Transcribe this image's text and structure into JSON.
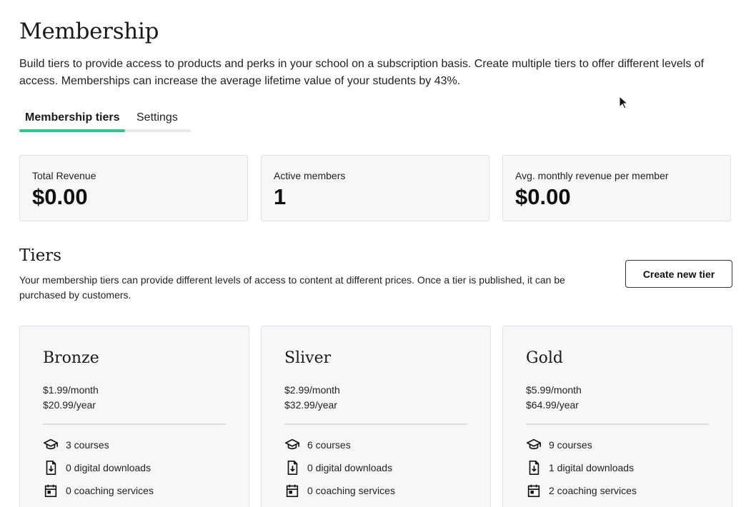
{
  "page": {
    "title": "Membership",
    "intro": "Build tiers to provide access to products and perks in your school on a subscription basis. Create multiple tiers to offer different levels of access. Memberships can increase the average lifetime value of your students by 43%."
  },
  "tabs": [
    {
      "label": "Membership tiers",
      "active": true
    },
    {
      "label": "Settings",
      "active": false
    }
  ],
  "accent_color": "#3bbf8c",
  "stats": [
    {
      "label": "Total Revenue",
      "value": "$0.00"
    },
    {
      "label": "Active members",
      "value": "1"
    },
    {
      "label": "Avg. monthly revenue per member",
      "value": "$0.00"
    }
  ],
  "tiers_section": {
    "heading": "Tiers",
    "description": "Your membership tiers can provide different levels of access to content at different prices. Once a tier is published, it can be purchased by customers.",
    "create_button": "Create new tier"
  },
  "tiers": [
    {
      "name": "Bronze",
      "monthly": "$1.99/month",
      "yearly": "$20.99/year",
      "features": [
        {
          "icon": "graduation-cap-icon",
          "text": "3 courses"
        },
        {
          "icon": "download-file-icon",
          "text": "0 digital downloads"
        },
        {
          "icon": "calendar-icon",
          "text": "0 coaching services"
        }
      ]
    },
    {
      "name": "Sliver",
      "monthly": "$2.99/month",
      "yearly": "$32.99/year",
      "features": [
        {
          "icon": "graduation-cap-icon",
          "text": "6 courses"
        },
        {
          "icon": "download-file-icon",
          "text": "0 digital downloads"
        },
        {
          "icon": "calendar-icon",
          "text": "0 coaching services"
        }
      ]
    },
    {
      "name": "Gold",
      "monthly": "$5.99/month",
      "yearly": "$64.99/year",
      "features": [
        {
          "icon": "graduation-cap-icon",
          "text": "9 courses"
        },
        {
          "icon": "download-file-icon",
          "text": "1 digital downloads"
        },
        {
          "icon": "calendar-icon",
          "text": "2 coaching services"
        }
      ]
    }
  ]
}
